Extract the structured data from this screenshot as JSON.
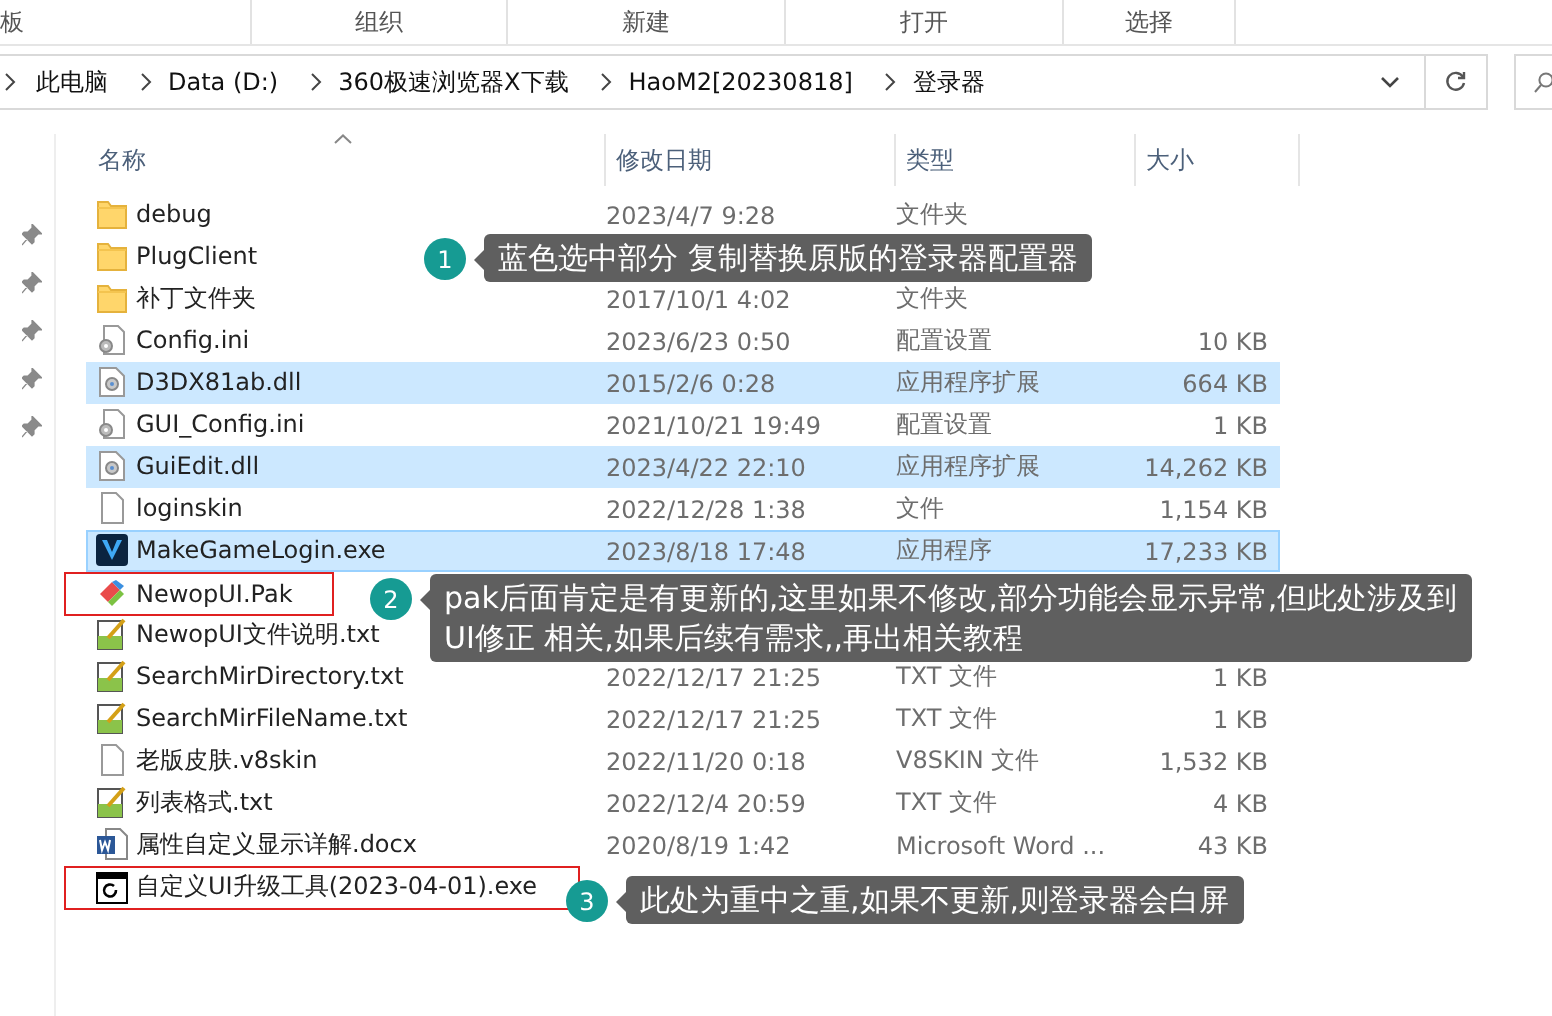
{
  "ribbon_groups": [
    "板",
    "组织",
    "新建",
    "打开",
    "选择"
  ],
  "address": {
    "path": [
      "此电脑",
      "Data (D:)",
      "360极速浏览器X下载",
      "HaoM2[20230818]",
      "登录器"
    ]
  },
  "columns": [
    "名称",
    "修改日期",
    "类型",
    "大小"
  ],
  "rows": [
    {
      "kind": "folder",
      "name": "debug",
      "date": "2023/4/7 9:28",
      "type": "文件夹",
      "selected": false,
      "marked": false
    },
    {
      "kind": "folder",
      "name": "PlugClient",
      "selected": false,
      "marked": false
    },
    {
      "kind": "folder",
      "name": "补丁文件夹",
      "date": "2017/10/1 4:02",
      "type": "文件夹",
      "selected": false,
      "marked": false
    },
    {
      "kind": "config",
      "name": "Config.ini",
      "date": "2023/6/23 0:50",
      "type": "配置设置",
      "size": "10 KB",
      "selected": false,
      "marked": false
    },
    {
      "kind": "dll",
      "name": "D3DX81ab.dll",
      "date": "2015/2/6 0:28",
      "type": "应用程序扩展",
      "size": "664 KB",
      "selected": true,
      "marked": false
    },
    {
      "kind": "config",
      "name": "GUI_Config.ini",
      "date": "2021/10/21 19:49",
      "type": "配置设置",
      "size": "1 KB",
      "selected": false,
      "marked": false
    },
    {
      "kind": "dll",
      "name": "GuiEdit.dll",
      "date": "2023/4/22 22:10",
      "type": "应用程序扩展",
      "size": "14,262 KB",
      "selected": true,
      "marked": false
    },
    {
      "kind": "blank",
      "name": "loginskin",
      "date": "2022/12/28 1:38",
      "type": "文件",
      "size": "1,154 KB",
      "selected": false,
      "marked": false
    },
    {
      "kind": "app",
      "name": "MakeGameLogin.exe",
      "date": "2023/8/18 17:48",
      "type": "应用程序",
      "size": "17,233 KB",
      "selected": true,
      "marked": false
    },
    {
      "kind": "pak",
      "name": "NewopUI.Pak",
      "selected": false,
      "marked": true
    },
    {
      "kind": "txt",
      "name": "NewopUI文件说明.txt",
      "selected": false,
      "marked": false
    },
    {
      "kind": "txt",
      "name": "SearchMirDirectory.txt",
      "date": "2022/12/17 21:25",
      "type": "TXT 文件",
      "size": "1 KB",
      "selected": false,
      "marked": false
    },
    {
      "kind": "txt",
      "name": "SearchMirFileName.txt",
      "date": "2022/12/17 21:25",
      "type": "TXT 文件",
      "size": "1 KB",
      "selected": false,
      "marked": false
    },
    {
      "kind": "blank",
      "name": "老版皮肤.v8skin",
      "date": "2022/11/20 0:18",
      "type": "V8SKIN 文件",
      "size": "1,532 KB",
      "selected": false,
      "marked": false
    },
    {
      "kind": "txt",
      "name": "列表格式.txt",
      "date": "2022/12/4 20:59",
      "type": "TXT 文件",
      "size": "4 KB",
      "selected": false,
      "marked": false
    },
    {
      "kind": "word",
      "name": "属性自定义显示详解.docx",
      "date": "2020/8/19 1:42",
      "type": "Microsoft Word ...",
      "size": "43 KB",
      "selected": false,
      "marked": false
    },
    {
      "kind": "exe",
      "name": "自定义UI升级工具(2023-04-01).exe",
      "selected": false,
      "marked": true
    }
  ],
  "callouts": [
    {
      "number": "1",
      "lines": [
        "蓝色选中部分 复制替换原版的登录器配置器"
      ]
    },
    {
      "number": "2",
      "lines": [
        "pak后面肯定是有更新的,这里如果不修改,部分功能会显示异常,但此处涉及到",
        "UI修正 相关,如果后续有需求,,再出相关教程"
      ]
    },
    {
      "number": "3",
      "lines": [
        "此处为重中之重,如果不更新,则登录器会白屏"
      ]
    }
  ]
}
